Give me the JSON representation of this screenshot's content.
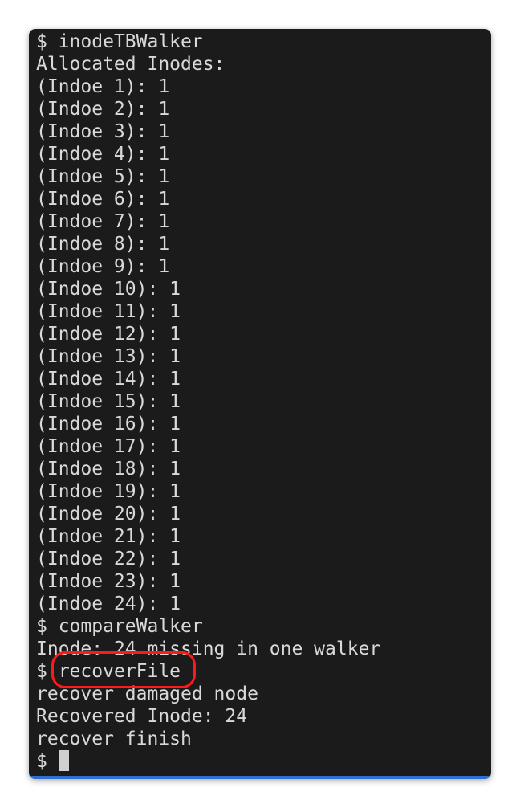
{
  "terminal": {
    "lines": [
      {
        "prompt": "$ ",
        "text": "inodeTBWalker"
      },
      {
        "text": "Allocated Inodes:"
      },
      {
        "text": "(Indoe 1): 1"
      },
      {
        "text": "(Indoe 2): 1"
      },
      {
        "text": "(Indoe 3): 1"
      },
      {
        "text": "(Indoe 4): 1"
      },
      {
        "text": "(Indoe 5): 1"
      },
      {
        "text": "(Indoe 6): 1"
      },
      {
        "text": "(Indoe 7): 1"
      },
      {
        "text": "(Indoe 8): 1"
      },
      {
        "text": "(Indoe 9): 1"
      },
      {
        "text": "(Indoe 10): 1"
      },
      {
        "text": "(Indoe 11): 1"
      },
      {
        "text": "(Indoe 12): 1"
      },
      {
        "text": "(Indoe 13): 1"
      },
      {
        "text": "(Indoe 14): 1"
      },
      {
        "text": "(Indoe 15): 1"
      },
      {
        "text": "(Indoe 16): 1"
      },
      {
        "text": "(Indoe 17): 1"
      },
      {
        "text": "(Indoe 18): 1"
      },
      {
        "text": "(Indoe 19): 1"
      },
      {
        "text": "(Indoe 20): 1"
      },
      {
        "text": "(Indoe 21): 1"
      },
      {
        "text": "(Indoe 22): 1"
      },
      {
        "text": "(Indoe 23): 1"
      },
      {
        "text": "(Indoe 24): 1"
      },
      {
        "prompt": "$ ",
        "text": "compareWalker"
      },
      {
        "text": "Inode: 24 missing in one walker"
      },
      {
        "prompt": "$ ",
        "text": "recoverFile",
        "highlighted": true
      },
      {
        "text": "recover damaged node"
      },
      {
        "text": "Recovered Inode: 24"
      },
      {
        "text": "recover finish"
      },
      {
        "prompt": "$ ",
        "text": "",
        "cursor": true
      }
    ]
  },
  "colors": {
    "background": "#1b1b1b",
    "text": "#d9d9d9",
    "highlight_circle": "#ff1a1a",
    "bottom_bar": "#2f6fd3"
  }
}
